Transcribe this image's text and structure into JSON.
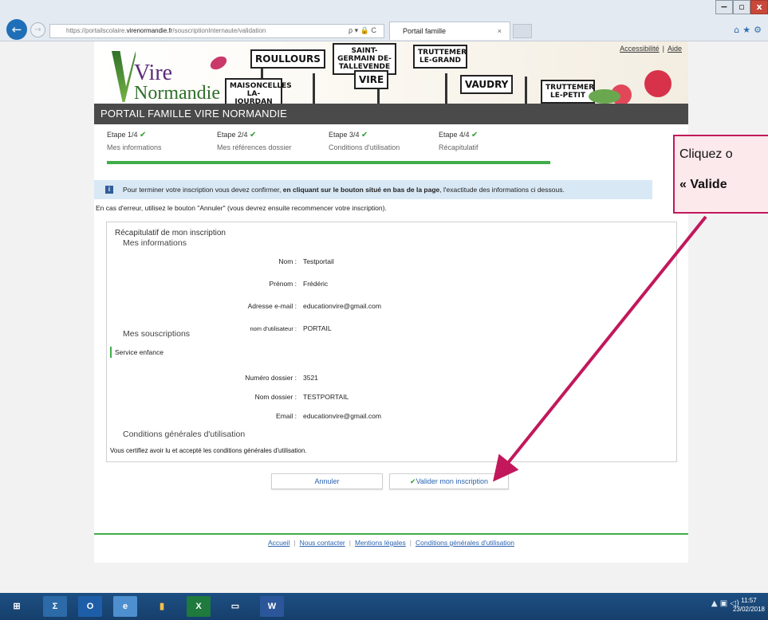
{
  "browser": {
    "url_prefix": "https://portailscolaire.",
    "url_domain": "virenormandie.fr",
    "url_path": "/souscriptionInternaute/validation",
    "tab_title": "Portail famille",
    "search_glyph": "ρ ▾ 🔒 C",
    "tab_close": "×",
    "window_controls": [
      "−",
      "▫",
      "x"
    ]
  },
  "header": {
    "logo_vire": "Vire",
    "logo_normandie": "Normandie",
    "signs": [
      "ROULLOURS",
      "SAINT-GERMAIN DE-TALLEVENDE",
      "TRUTTEMER LE-GRAND",
      "MAISONCELLES LA-JOURDAN",
      "VIRE",
      "VAUDRY",
      "TRUTTEMER LE-PETIT"
    ],
    "accessibility_link": "Accessibilité",
    "help_link": "Aide",
    "separator": "|",
    "portal_title": "PORTAIL FAMILLE VIRE NORMANDIE"
  },
  "steps": [
    {
      "label": "Etape 1/4",
      "sub": "Mes informations"
    },
    {
      "label": "Etape 2/4",
      "sub": "Mes références dossier"
    },
    {
      "label": "Etape 3/4",
      "sub": "Conditions d'utilisation"
    },
    {
      "label": "Etape 4/4",
      "sub": "Récapitulatif"
    }
  ],
  "info": {
    "icon": "i",
    "text_before": "Pour terminer votre inscription vous devez confirmer, ",
    "text_bold": "en cliquant sur le bouton situé en bas de la page",
    "text_after": ", l'exactitude des informations ci dessous."
  },
  "note": "En cas d'erreur, utilisez le bouton \"Annuler\" (vous devrez ensuite recommencer votre inscription).",
  "recap": {
    "title": "Récapitulatif de mon inscription",
    "section_info": "Mes informations",
    "fields": [
      {
        "key": "Nom :",
        "value": "Testportail"
      },
      {
        "key": "Prénom :",
        "value": "Frédéric"
      },
      {
        "key": "Adresse e-mail :",
        "value": "educationvire@gmail.com"
      },
      {
        "key": "nom d'utilisateur :",
        "value": "PORTAIL"
      }
    ],
    "section_subs": "Mes souscriptions",
    "service": "Service enfance",
    "dossier_fields": [
      {
        "key": "Numéro dossier :",
        "value": "3521"
      },
      {
        "key": "Nom dossier :",
        "value": "TESTPORTAIL"
      },
      {
        "key": "Email :",
        "value": "educationvire@gmail.com"
      }
    ],
    "section_cgu": "Conditions générales d'utilisation",
    "certify": "Vous certifiez avoir lu et accepté les conditions générales d'utilisation."
  },
  "buttons": {
    "cancel": "Annuler",
    "validate": "Valider mon inscription"
  },
  "footer": {
    "links": [
      "Accueil",
      "Nous contacter",
      "Mentions légales",
      "Conditions générales d'utilisation"
    ],
    "separator": "|"
  },
  "callout": {
    "line1": "Cliquez o",
    "line2": "« Valide"
  },
  "taskbar": {
    "apps": [
      "⊞",
      "Σ",
      "O",
      "e",
      "▮",
      "X",
      "▭",
      "W"
    ],
    "tray": "▲ ▣ ◁)",
    "time": "11:57",
    "date": "23/02/2018"
  },
  "colors": {
    "accent_green": "#3fae49",
    "title_bar": "#4a4a4a",
    "link_blue": "#2b63b0",
    "info_bg": "#d9e8f5",
    "arrow": "#c2185b"
  }
}
